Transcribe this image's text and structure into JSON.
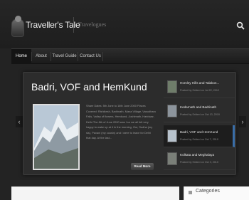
{
  "header": {
    "site_title": "Traveller's Tale",
    "tagline": "Travelogues",
    "search_icon": "search-icon"
  },
  "nav": {
    "items": [
      {
        "label": "Home",
        "active": true
      },
      {
        "label": "About",
        "active": false
      },
      {
        "label": "Travel Guide",
        "active": false
      },
      {
        "label": "Contact Us",
        "active": false
      }
    ]
  },
  "featured": {
    "title": "Badri, VOF and HemKund",
    "excerpt": "Share Dates: 5th June to 16th June 2000 Places Covered: Rishikesh, Badrinath, Mana Village, Vasudhara Falls, Valley of flowers, Hemkund, Joshimath, Haridwar, Delhi The 8th of June 2000 was I so we all felt very happy to wake up at 4 in the morning. Our, Sudha (my sis), Pavani (my cousin) and I were to leave for Delhi that day. At the last...",
    "read_more_label": "Read More",
    "prev_label": "‹",
    "next_label": "›"
  },
  "slides": [
    {
      "title": "Horsley Hills and Talakon...",
      "meta": "Posted by Sridevi on Jul 22, 2012",
      "active": false
    },
    {
      "title": "Kedarnath and Badrinath",
      "meta": "Posted by Sridevi on Oct 13, 2010",
      "active": false
    },
    {
      "title": "Badri, VOF and HemKund",
      "meta": "Posted by Sridevi on Oct 7, 2010",
      "active": true
    },
    {
      "title": "Kolkata and Meghalaya",
      "meta": "Posted by Sridevi on Oct 3, 2010",
      "active": false
    }
  ],
  "sidebar": {
    "categories_title": "Categories"
  },
  "colors": {
    "background": "#232323",
    "accent_blue": "#3a6ea8",
    "content_bg": "#f4f4f4"
  }
}
